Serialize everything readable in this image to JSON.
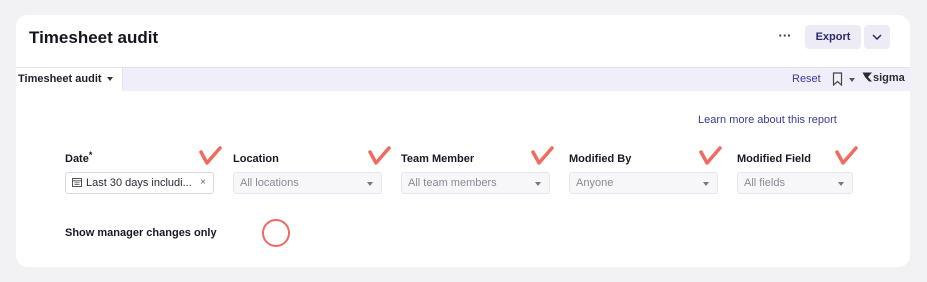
{
  "header": {
    "title": "Timesheet audit",
    "more_label": "···",
    "export_label": "Export"
  },
  "toolbar": {
    "tab_label": "Timesheet audit",
    "reset_label": "Reset",
    "logo_text": "sigma"
  },
  "learn_more": "Learn more about this report",
  "filters": [
    {
      "label": "Date",
      "required_mark": "*",
      "value": "Last 30 days includi...",
      "clear": "×"
    },
    {
      "label": "Location",
      "placeholder": "All locations"
    },
    {
      "label": "Team Member",
      "placeholder": "All team members"
    },
    {
      "label": "Modified By",
      "placeholder": "Anyone"
    },
    {
      "label": "Modified Field",
      "placeholder": "All fields"
    }
  ],
  "manager_toggle_label": "Show manager changes only",
  "colors": {
    "accent": "#3b3a9c",
    "annotation": "#f06a5f",
    "toolbar_bg": "#f0eff9"
  }
}
